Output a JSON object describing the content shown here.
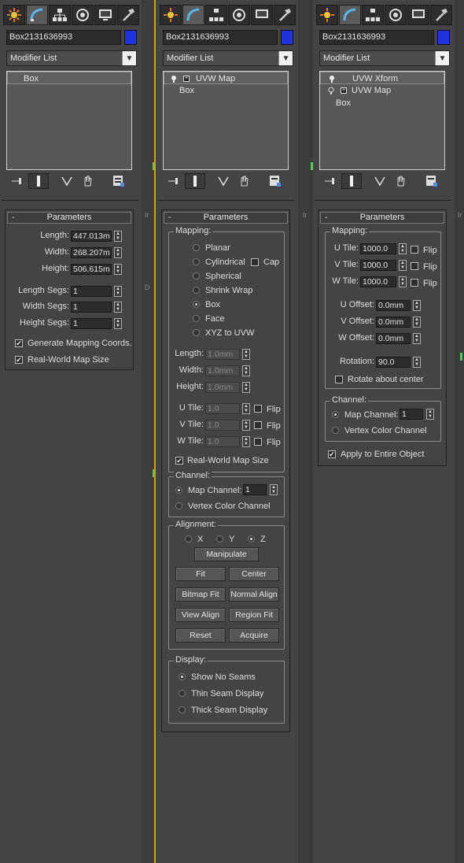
{
  "tabs": [
    "create",
    "modify",
    "hierarchy",
    "motion",
    "display",
    "utilities"
  ],
  "panels": [
    {
      "object_name": "Box2131636993",
      "color": "#1f33dd",
      "modifier_list": "Modifier List",
      "stack": [
        {
          "label": "Box",
          "selected": true
        }
      ],
      "rollout": "Parameters",
      "length_label": "Length:",
      "length": "447.013m",
      "width_label": "Width:",
      "width": "268.207m",
      "height_label": "Height:",
      "height": "506.615m",
      "lsegs_label": "Length Segs:",
      "lsegs": "1",
      "wsegs_label": "Width Segs:",
      "wsegs": "1",
      "hsegs_label": "Height Segs:",
      "hsegs": "1",
      "gen_map": "Generate Mapping Coords.",
      "real_world": "Real-World Map Size"
    },
    {
      "object_name": "Box2131636993",
      "modifier_list": "Modifier List",
      "stack": [
        {
          "label": "UVW Map",
          "selected": true
        },
        {
          "label": "Box"
        }
      ],
      "rollout": "Parameters",
      "mapping_label": "Mapping:",
      "mapping": [
        "Planar",
        "Cylindrical",
        "Spherical",
        "Shrink Wrap",
        "Box",
        "Face",
        "XYZ to UVW"
      ],
      "mapping_selected": "Box",
      "cap": "Cap",
      "length_label": "Length:",
      "length": "1.0mm",
      "width_label": "Width:",
      "width": "1.0mm",
      "height_label": "Height:",
      "height": "1.0mm",
      "utile_label": "U Tile:",
      "utile": "1.0",
      "vtile_label": "V Tile:",
      "vtile": "1.0",
      "wtile_label": "W Tile:",
      "wtile": "1.0",
      "flip": "Flip",
      "real_world": "Real-World Map Size",
      "channel_label": "Channel:",
      "map_channel": "Map Channel:",
      "map_channel_val": "1",
      "vertex_color": "Vertex Color Channel",
      "alignment_label": "Alignment:",
      "axes": [
        "X",
        "Y",
        "Z"
      ],
      "axis_selected": "Z",
      "manipulate": "Manipulate",
      "fit": "Fit",
      "center": "Center",
      "bitmap_fit": "Bitmap Fit",
      "normal_align": "Normal Align",
      "view_align": "View Align",
      "region_fit": "Region Fit",
      "reset": "Reset",
      "acquire": "Acquire",
      "display_label": "Display:",
      "display": [
        "Show No Seams",
        "Thin Seam Display",
        "Thick Seam Display"
      ],
      "display_selected": "Show No Seams"
    },
    {
      "object_name": "Box2131636993",
      "modifier_list": "Modifier List",
      "stack": [
        {
          "label": "UVW Xform",
          "selected": true
        },
        {
          "label": "UVW Map"
        },
        {
          "label": "Box"
        }
      ],
      "rollout": "Parameters",
      "mapping_label": "Mapping:",
      "utile_label": "U Tile:",
      "utile": "1000.0",
      "vtile_label": "V Tile:",
      "vtile": "1000.0",
      "wtile_label": "W Tile:",
      "wtile": "1000.0",
      "flip": "Flip",
      "uoff_label": "U Offset:",
      "uoff": "0.0mm",
      "voff_label": "V Offset:",
      "voff": "0.0mm",
      "woff_label": "W Offset:",
      "woff": "0.0mm",
      "rotation_label": "Rotation:",
      "rotation": "90.0",
      "rotate_center": "Rotate about center",
      "channel_label": "Channel:",
      "map_channel": "Map Channel:",
      "map_channel_val": "1",
      "vertex_color": "Vertex Color Channel",
      "apply_entire": "Apply to Entire Object"
    }
  ]
}
